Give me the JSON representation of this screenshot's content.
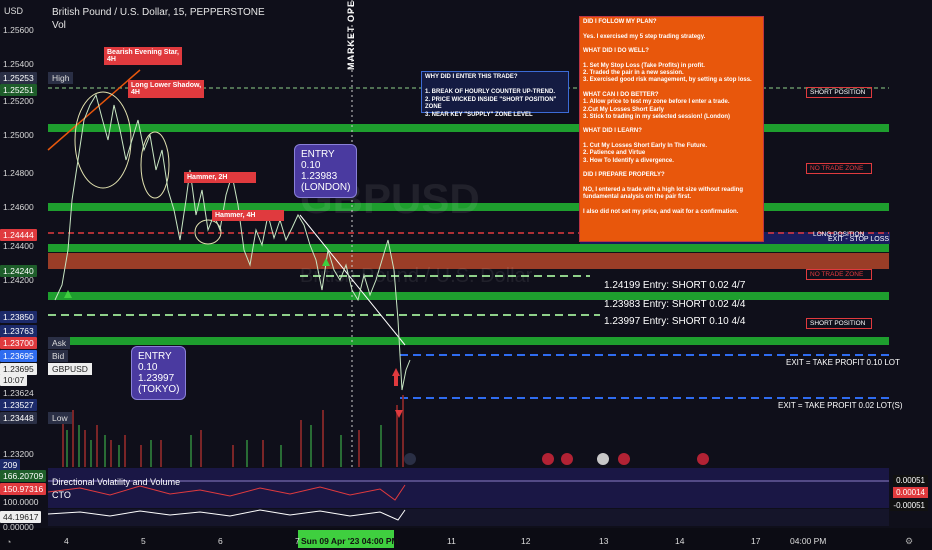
{
  "header": {
    "currency": "USD",
    "symbol_line": "British Pound / U.S. Dollar, 15, PEPPERSTONE",
    "vol": "Vol",
    "watermark_symbol": "GBPUSD",
    "watermark_name": "British Pound / U.S. Dollar"
  },
  "axis": {
    "prices": [
      "1.25600",
      "1.25400",
      "1.25253",
      "1.25251",
      "1.25200",
      "1.25000",
      "1.24800",
      "1.24600",
      "1.24444",
      "1.24400",
      "1.24240",
      "1.24200",
      "1.23850",
      "1.23763",
      "1.23700",
      "1.23695",
      "1.23695",
      "1.23624",
      "1.23527",
      "1.23448",
      "1.23200"
    ],
    "tag_high": "High",
    "tag_ask": "Ask",
    "tag_bid": "Bid",
    "tag_gbpusd": "GBPUSD",
    "tag_low": "Low",
    "countdown": "10:07",
    "dates": [
      "4",
      "5",
      "6",
      "7",
      "Sun 09 Apr '23",
      "04:00 PM",
      "11",
      "12",
      "13",
      "14",
      "17",
      "04:00 PM"
    ],
    "cursor_date": "Sun 09 Apr '23   04:00 PM"
  },
  "annotations": {
    "market_open": "MARKET OPEN",
    "bearish": "Bearish Evening Star,\n4H",
    "long_lower": "Long Lower Shadow,\n4H",
    "hammer1": "Hammer, 2H",
    "hammer2": "Hammer, 4H",
    "entry_london": "ENTRY\n0.10\n1.23983\n(LONDON)",
    "entry_tokyo": "ENTRY\n0.10\n1.23997\n(TOKYO)",
    "why_box": "WHY DID I ENTER THIS TRADE?\n\n1. BREAK OF HOURLY COUNTER UP-TREND.\n2. PRICE WICKED INSIDE \"SHORT POSITION\" ZONE\n3. NEAR KEY \"SUPPLY\" ZONE LEVEL",
    "review_panel": "DID I FOLLOW MY PLAN?\n\nYes. I exercised my 5 step trading strategy.\n\nWHAT DID I DO WELL?\n\n1. Set My Stop Loss (Take Profits) in profit.\n2. Traded the pair in a new session.\n3. Exercised good risk management, by setting a stop loss.\n\nWHAT CAN I DO BETTER?\n1. Allow price to test my zone before I enter a trade.\n2.Cut My Losses Short Early\n3. Stick to trading in my selected session! (London)\n\nWHAT DID I LEARN?\n\n1. Cut My Losses Short Early In The Future.\n2. Patience and Virtue\n3. How To Identify a divergence.\n\nDID I PREPARE PROPERLY?\n\nNO, I entered a trade with a high lot size without reading fundamental analysis on the pair first.\n\nI also did not set my price, and wait for a confirmation.",
    "short_position_top": "SHORT POSITION",
    "no_trade_zone_1": "NO TRADE ZONE",
    "long_position": "LONG POSITION",
    "exit_stop_loss": "EXIT - STOP LOSS",
    "no_trade_zone_2": "NO TRADE ZONE",
    "short_position_bottom": "SHORT POSITION",
    "entry_line_1": "1.24199 Entry: SHORT 0.02 4/7",
    "entry_line_2": "1.23983 Entry: SHORT 0.02 4/4",
    "entry_line_3": "1.23997 Entry: SHORT 0.10 4/4",
    "exit_tp_010": "EXIT = TAKE PROFIT 0.10 LOT",
    "exit_tp_002": "EXIT = TAKE PROFIT 0.02 LOT(S)"
  },
  "indicators": {
    "vol_left": "209",
    "dvv_title": "Directional Volatility and Volume",
    "cto": "CTO",
    "left_166": "166.20709",
    "left_150": "150.97316",
    "left_100": "100.0000",
    "left_44": "44.19617",
    "left_0": "0.00000",
    "right_1": "0.00051",
    "right_2": "0.00014",
    "right_3": "-0.00051"
  },
  "colors": {
    "green_zone": "#1e9e2e",
    "red_zone": "#b3452a",
    "price_green": "#8fd08a",
    "blue_dash": "#2f6cf0",
    "review_orange": "#e8570c"
  }
}
